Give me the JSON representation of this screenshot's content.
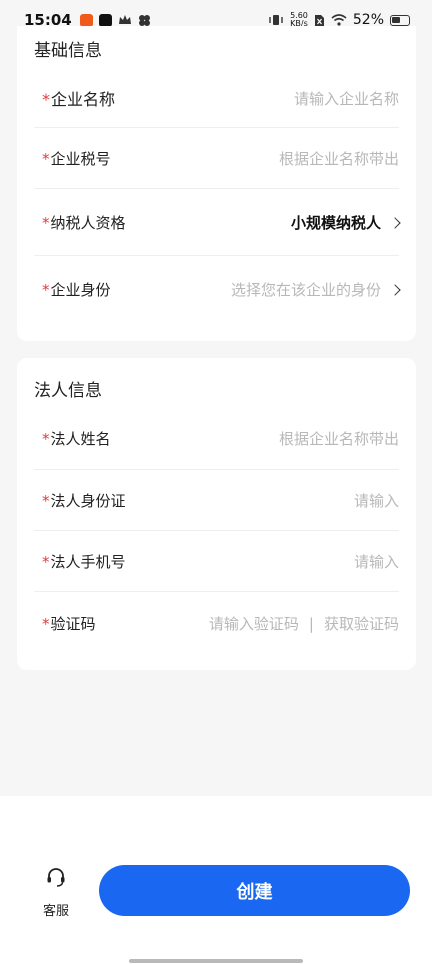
{
  "status_bar": {
    "time": "15:04",
    "net_speed_value": "5.60",
    "net_speed_unit": "KB/s",
    "battery": "52%"
  },
  "basic_info": {
    "title": "基础信息",
    "required_mark": "*",
    "rows": [
      {
        "label": "企业名称",
        "value": "请输入企业名称"
      },
      {
        "label": "企业税号",
        "value": "根据企业名称带出"
      },
      {
        "label": "纳税人资格",
        "value": "小规模纳税人"
      },
      {
        "label": "企业身份",
        "value": "选择您在该企业的身份"
      }
    ]
  },
  "legal_info": {
    "title": "法人信息",
    "rows": [
      {
        "label": "法人姓名",
        "value": "根据企业名称带出"
      },
      {
        "label": "法人身份证",
        "value": "请输入"
      },
      {
        "label": "法人手机号",
        "value": "请输入"
      },
      {
        "label": "验证码",
        "value": "请输入验证码",
        "separator": "|",
        "action": "获取验证码"
      }
    ]
  },
  "bottom": {
    "service_label": "客服",
    "create_label": "创建"
  },
  "colors": {
    "primary": "#1a68f1",
    "required": "#e23c3c",
    "placeholder": "#b8b8b8"
  }
}
